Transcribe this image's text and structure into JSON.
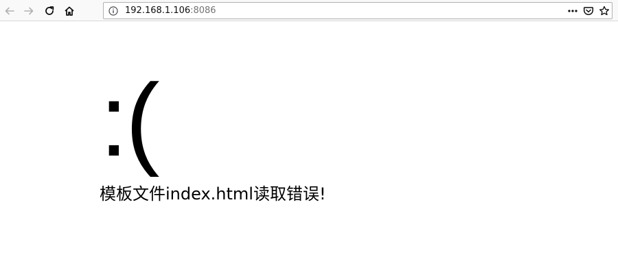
{
  "browser": {
    "address": {
      "host": "192.168.1.106",
      "port": ":8086"
    },
    "icons": {
      "back": "back-arrow-icon",
      "forward": "forward-arrow-icon",
      "reload": "reload-icon",
      "home": "home-icon",
      "info": "info-icon",
      "more": "more-dots-icon",
      "pocket": "pocket-icon",
      "bookmark": "star-icon"
    }
  },
  "page": {
    "face": ":(",
    "message": "模板文件index.html读取错误!"
  }
}
